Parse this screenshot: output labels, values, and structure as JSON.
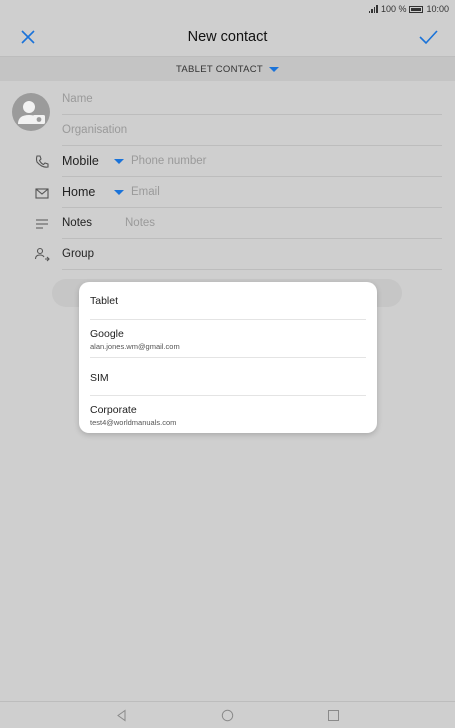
{
  "status": {
    "signal_percent": "100 %",
    "time": "10:00"
  },
  "header": {
    "title": "New contact"
  },
  "account": {
    "label": "TABLET CONTACT"
  },
  "fields": {
    "name_placeholder": "Name",
    "organisation_placeholder": "Organisation",
    "phone_type": "Mobile",
    "phone_placeholder": "Phone number",
    "email_type": "Home",
    "email_placeholder": "Email",
    "notes_label": "Notes",
    "notes_placeholder": "Notes",
    "group_label": "Group"
  },
  "popup": {
    "options": [
      {
        "label": "Tablet",
        "sub": ""
      },
      {
        "label": "Google",
        "sub": "alan.jones.wm@gmail.com"
      },
      {
        "label": "SIM",
        "sub": ""
      },
      {
        "label": "Corporate",
        "sub": "test4@worldmanuals.com"
      }
    ]
  },
  "colors": {
    "accent": "#1a73d9",
    "scrim": "#cfcfcf",
    "popup_bg": "#ffffff"
  }
}
